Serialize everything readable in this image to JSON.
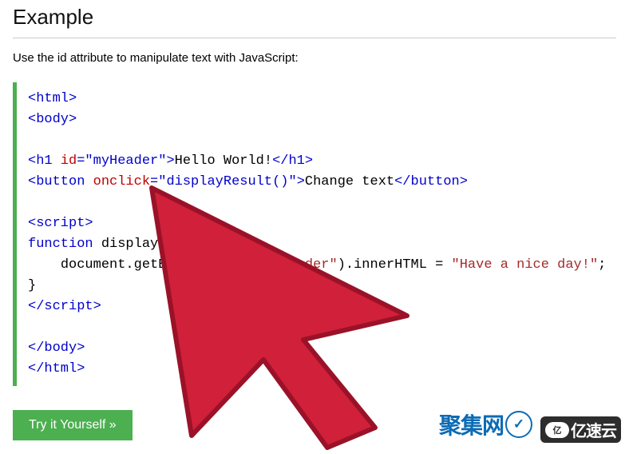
{
  "heading": "Example",
  "description": "Use the id attribute to manipulate text with JavaScript:",
  "code": {
    "l1_open_html": "<html>",
    "l2_open_body": "<body>",
    "l3_blank": "",
    "l4": {
      "open_h1": "<h1 ",
      "attr_id": "id",
      "eq": "=",
      "val_id": "\"myHeader\"",
      "close_open": ">",
      "text": "Hello World!",
      "close_h1": "</h1>"
    },
    "l5": {
      "open_btn": "<button ",
      "attr_onclick": "onclick",
      "eq": "=",
      "val_onclick": "\"displayResult()\"",
      "close_open": ">",
      "text": "Change text",
      "close_btn": "</button>"
    },
    "l6_blank": "",
    "l7_open_script": "<script>",
    "l8": {
      "fn_kw": "function",
      "fn_rest": " displayResult() {"
    },
    "l9": {
      "indent": "    ",
      "doc": "document.getElementById(",
      "arg": "\"myHeader\"",
      "after": ").innerHTML = ",
      "str": "\"Have a nice day!\"",
      "semi": ";"
    },
    "l10_close_brace": "}",
    "l11_close_script": "</scr",
    "l11_close_script_b": "ipt>",
    "l12_blank": "",
    "l13_close_body": "</body>",
    "l14_close_html": "</html>"
  },
  "button_label": "Try it Yourself »",
  "logos": {
    "left_text": "聚集网",
    "left_bubble": "✓",
    "right_cloud": "亿",
    "right_text": "亿速云"
  }
}
